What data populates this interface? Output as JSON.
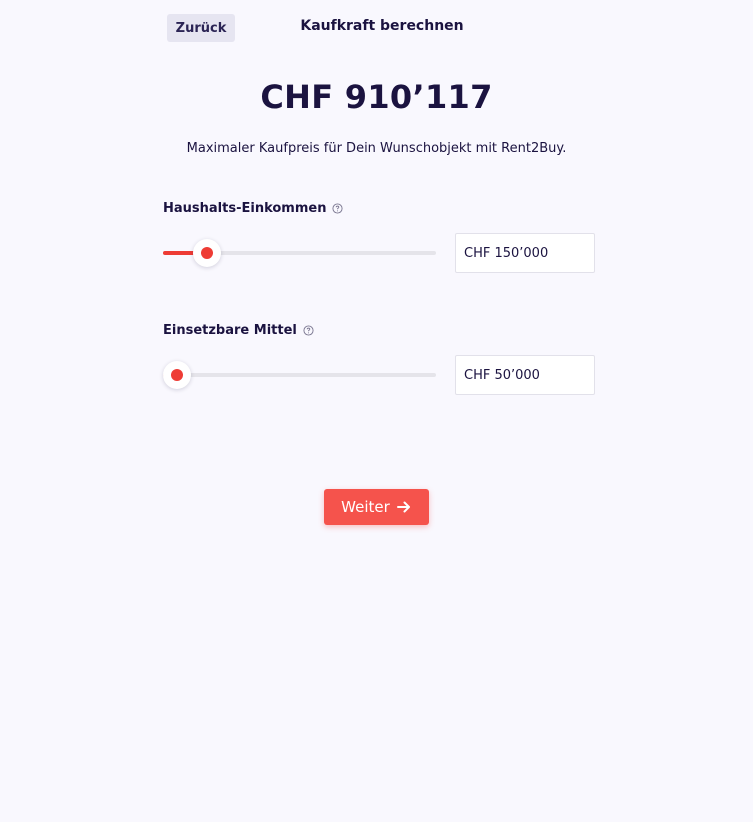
{
  "header": {
    "back_label": "Zurück",
    "title": "Kaufkraft berechnen"
  },
  "result": {
    "amount": "CHF 910’117",
    "subtitle": "Maximaler Kaufpreis für Dein Wunschobjekt mit Rent2Buy."
  },
  "fields": [
    {
      "label": "Haushalts-Einkommen",
      "help_icon": "question-circle-icon",
      "value": "CHF 150’000",
      "slider_fraction": 0.16
    },
    {
      "label": "Einsetzbare Mittel",
      "help_icon": "question-circle-icon",
      "value": "CHF 50’000",
      "slider_fraction": 0.05
    }
  ],
  "actions": {
    "next_label": "Weiter",
    "next_icon": "arrow-right-icon"
  },
  "colors": {
    "accent": "#ee3c35",
    "button": "#f5534c",
    "text": "#1b1340",
    "background": "#f9f8fe"
  }
}
